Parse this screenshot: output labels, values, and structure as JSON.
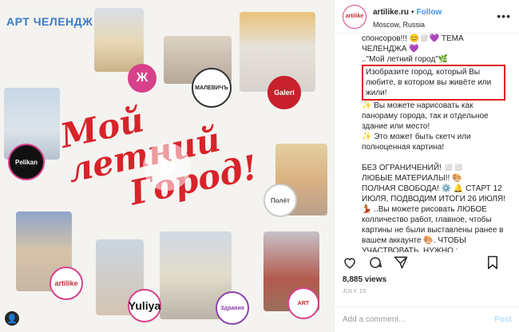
{
  "image": {
    "brand": "АРТ ЧЕЛЕНДЖ",
    "headline_line1": "Мой летний",
    "headline_line2": "Город!",
    "logos": [
      "Ж",
      "МАЛЕВИЧЪ",
      "Galeri",
      "Pelikan",
      "Полёт",
      "artilike",
      "Yuliya",
      "Здравия",
      "ART"
    ],
    "play_icon": "play-icon"
  },
  "header": {
    "username": "artilike.ru",
    "dot": "•",
    "follow": "Follow",
    "location": "Moscow, Russia",
    "avatar_text": "artilike"
  },
  "caption": {
    "p1": "спонсоров!!! 😊◻️💜 ТЕМА ЧЕЛЕНДЖА 💜",
    "p2": "..\"Мой летний город\"🌿",
    "p3_highlight": "Изобразите город, который Вы любите, в котором вы живёте или жили!",
    "p4": "✨ Вы можете нарисовать как панораму города, так и отдельное здание или место!",
    "p5": "✨ Это может быть скетч или полноценная картина!",
    "p6": "БЕЗ ОГРАНИЧЕНИЙ! ◻️◻️",
    "p7": "ЛЮБЫЕ МАТЕРИАЛЫ!! 🎨",
    "p8": "ПОЛНАЯ СВОБОДА! ⚙️ 🔔 СТАРТ 12 ИЮЛЯ, ПОДВОДИМ ИТОГИ 26 ИЮЛЯ! 💃 ..Вы можете рисовать ЛЮБОЕ колличество работ, главное, чтобы картины не были выставлены ранее в вашем аккаунте 🎨. ЧТОБЫ УЧАСТВОВАТЬ, НУЖНО :"
  },
  "stats": {
    "views": "8,885 views",
    "date": "JULY 10"
  },
  "comment": {
    "placeholder": "Add a comment...",
    "post": "Post"
  },
  "colors": {
    "accent": "#3897f0",
    "highlight_border": "#e0151f",
    "headline": "#d8232a"
  }
}
